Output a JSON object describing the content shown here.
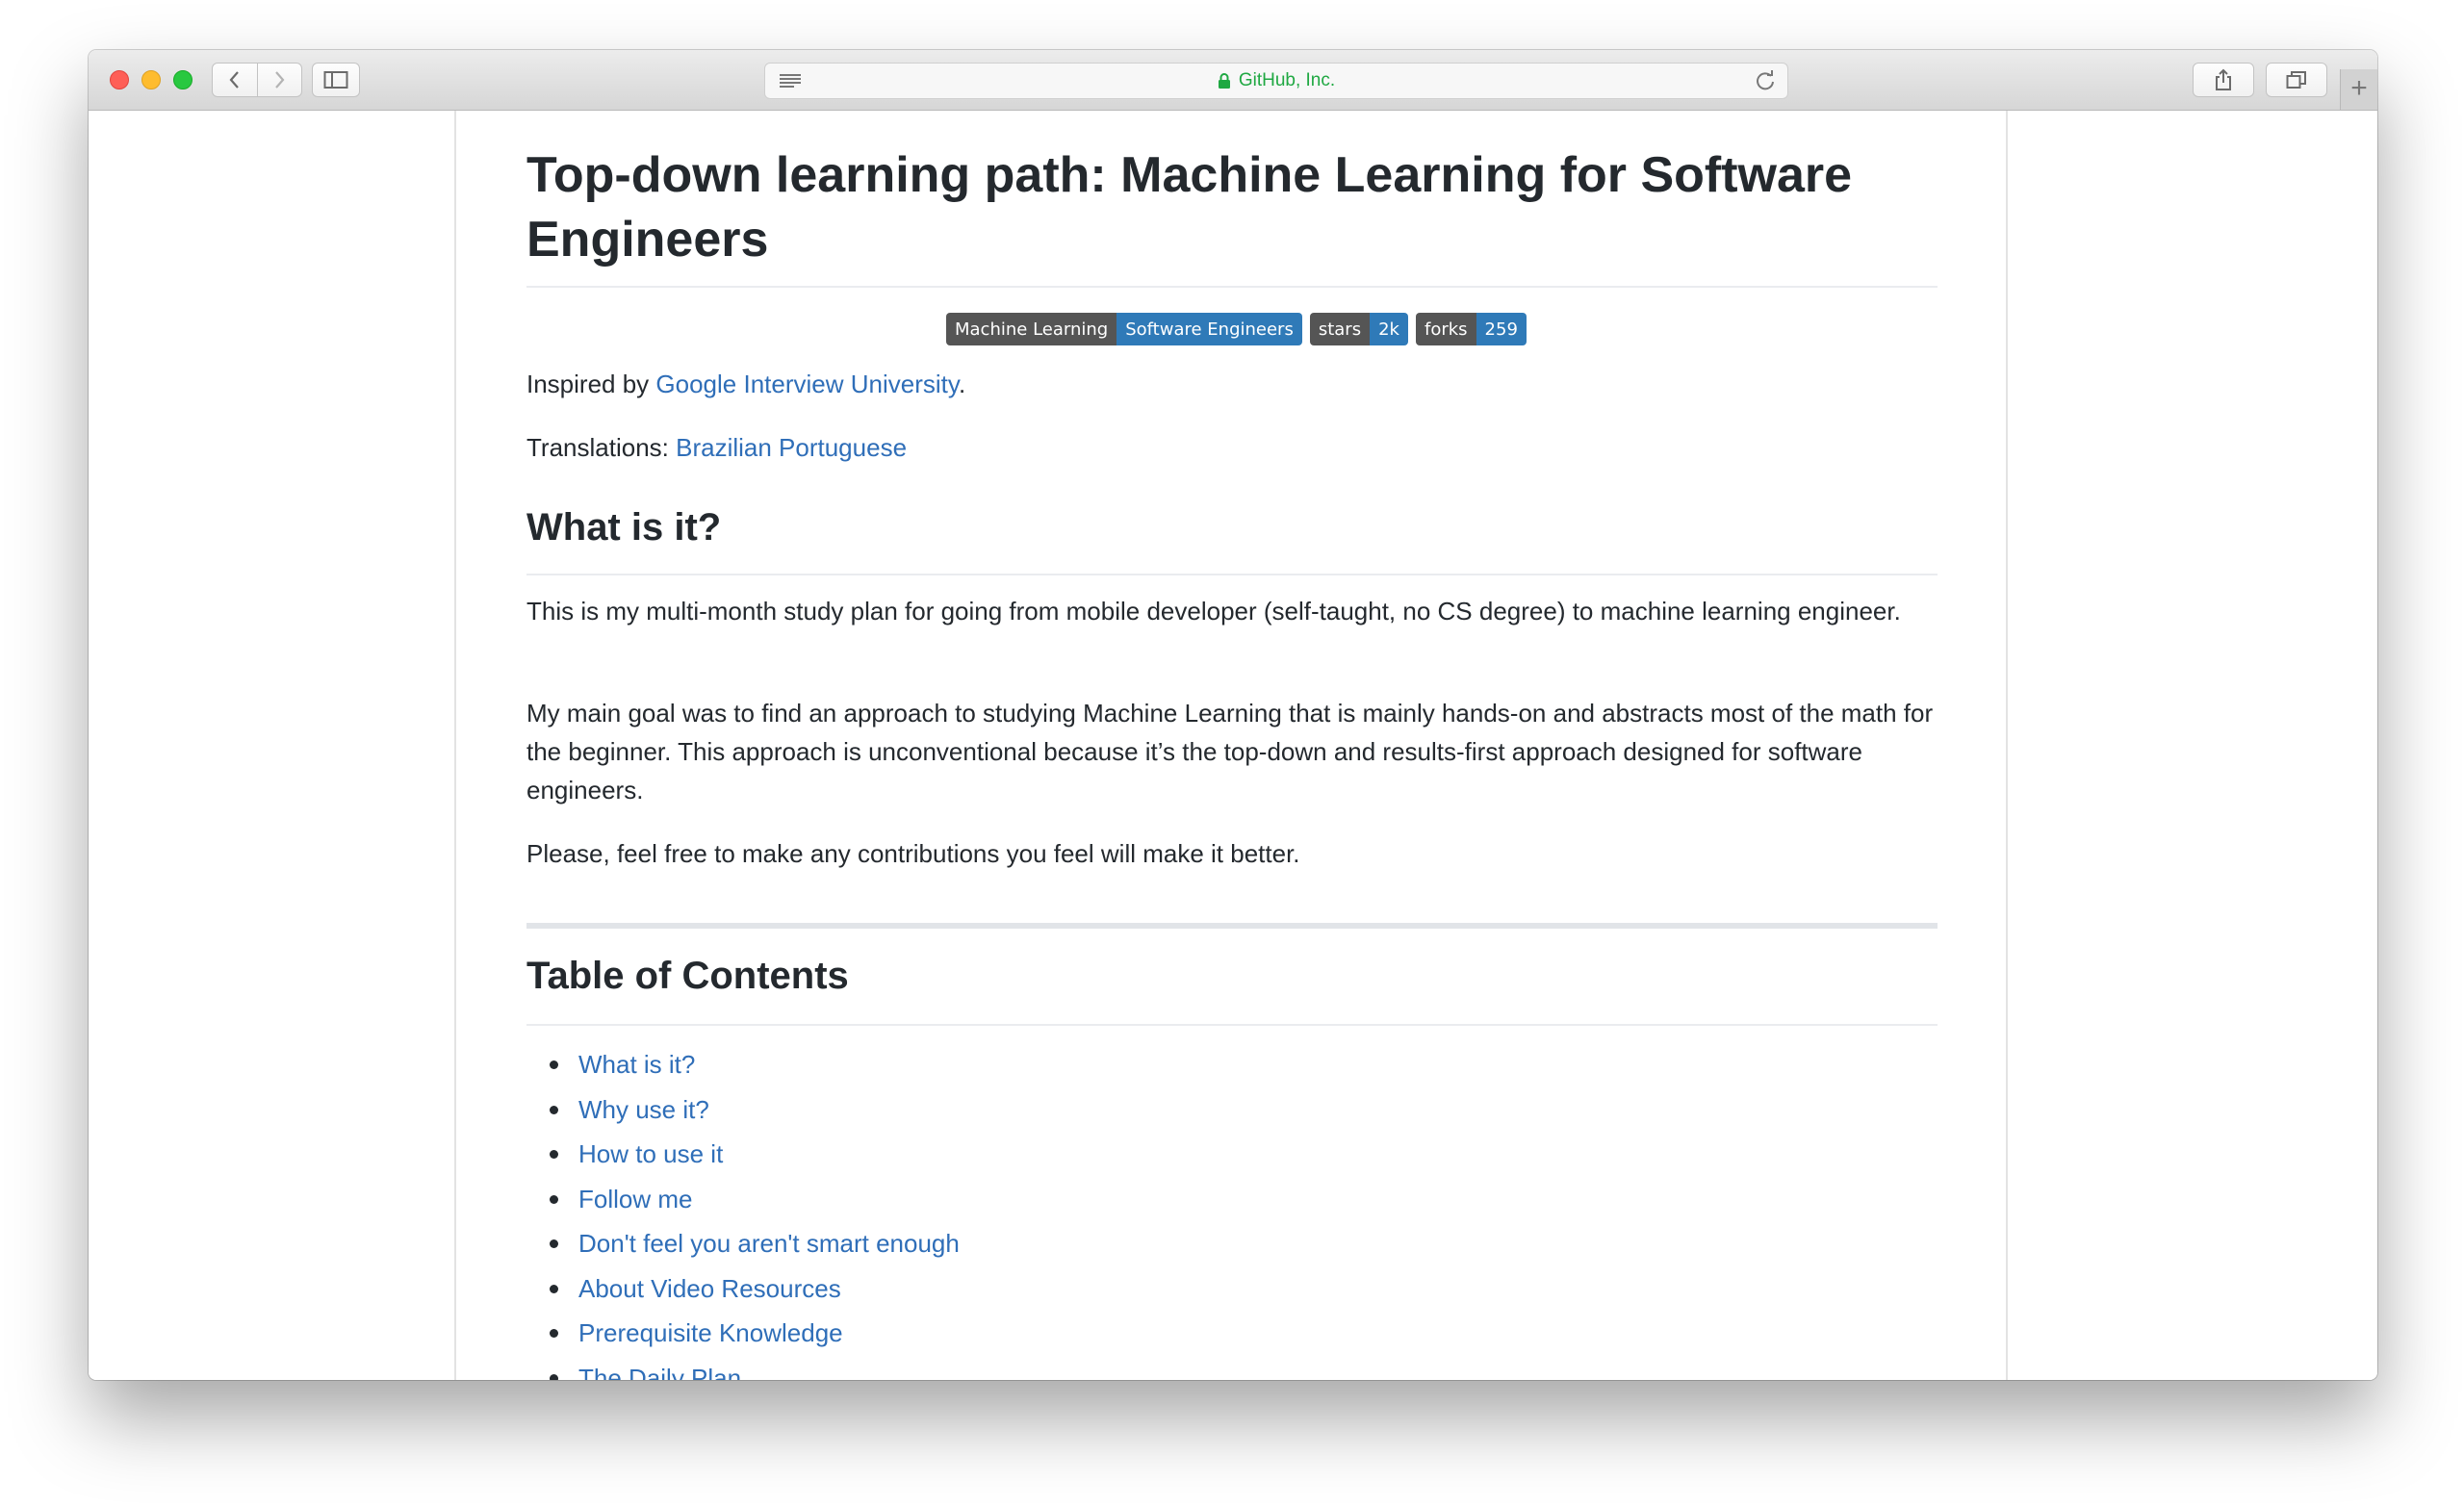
{
  "browser": {
    "site_label": "GitHub, Inc.",
    "accent_green": "#1fa842"
  },
  "article": {
    "title": "Top-down learning path: Machine Learning for Software Engineers",
    "badges": [
      {
        "left": "Machine Learning",
        "right": "Software Engineers"
      },
      {
        "left": "stars",
        "right": "2k"
      },
      {
        "left": "forks",
        "right": "259"
      }
    ],
    "inspired_prefix": "Inspired by ",
    "inspired_link": "Google Interview University",
    "inspired_suffix": ".",
    "translations_prefix": "Translations: ",
    "translations_link": "Brazilian Portuguese",
    "section_what": "What is it?",
    "para1": "This is my multi-month study plan for going from mobile developer (self-taught, no CS degree) to machine learning engineer.",
    "para2": "My main goal was to find an approach to studying Machine Learning that is mainly hands-on and abstracts most of the math for the beginner. This approach is unconventional because it’s the top-down and results-first approach designed for software engineers.",
    "para3": "Please, feel free to make any contributions you feel will make it better.",
    "toc_heading": "Table of Contents",
    "toc": [
      "What is it?",
      "Why use it?",
      "How to use it",
      "Follow me",
      "Don't feel you aren't smart enough",
      "About Video Resources",
      "Prerequisite Knowledge",
      "The Daily Plan"
    ],
    "link_color": "#2f6eb8"
  }
}
